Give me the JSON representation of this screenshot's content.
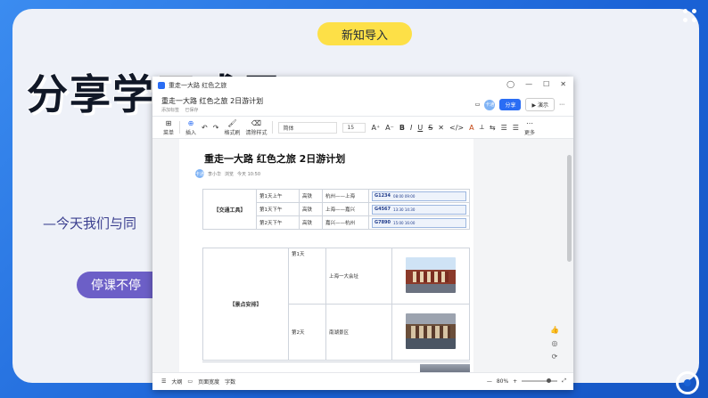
{
  "slide": {
    "pill_label": "新知导入",
    "big_title": "分享学习成果",
    "sub_text": "—今天我们与同",
    "purple_pill": "停课不停",
    "colors": {
      "background": "#1a62d6",
      "card": "#eef1f8",
      "pill": "#fde047",
      "purple": "#6c5fc7"
    }
  },
  "window": {
    "title": "重走一大路 红色之旅",
    "controls": [
      "◯",
      "—",
      "☐",
      "✕"
    ],
    "doc_name": "重走一大路 红色之旅 2日游计划",
    "doc_sub": [
      "添加标签",
      "已保存"
    ],
    "share_label": "分享",
    "present_label": "演示",
    "avatar_text": "卡通"
  },
  "toolbar": {
    "items": [
      {
        "icon": "grid-icon",
        "glyph": "⊞",
        "label": "菜单"
      },
      {
        "icon": "insert-icon",
        "glyph": "⊕",
        "label": "插入"
      },
      {
        "icon": "undo-icon",
        "glyph": "↶",
        "label": ""
      },
      {
        "icon": "redo-icon",
        "glyph": "↷",
        "label": ""
      },
      {
        "icon": "paint-icon",
        "glyph": "🖌",
        "label": "格式刷"
      },
      {
        "icon": "eraser-icon",
        "glyph": "⌫",
        "label": "清除样式"
      }
    ],
    "font": "简体",
    "size": "15",
    "format_glyphs": [
      "A⁺",
      "A⁻",
      "B",
      "I",
      "U",
      "S",
      "✕",
      "</>",
      "A",
      "⟂",
      "⇆",
      "☰",
      "☰",
      "⋯"
    ],
    "more_label": "更多"
  },
  "document": {
    "title": "重走一大路 红色之旅 2日游计划",
    "author_avatar": "卡通",
    "author": "李小华",
    "meta": "浏览",
    "time": "今天 10:50",
    "transport_label": "【交通工具】",
    "transport_rows": [
      {
        "day": "第1天上午",
        "mode": "高铁",
        "route": "杭州——上海",
        "code": "G1234",
        "times": "08:00 09:00"
      },
      {
        "day": "第1天下午",
        "mode": "高铁",
        "route": "上海——嘉兴",
        "code": "G4567",
        "times": "13:30 14:30"
      },
      {
        "day": "第2天下午",
        "mode": "高铁",
        "route": "嘉兴——杭州",
        "code": "G7890",
        "times": "15:00 16:00"
      }
    ],
    "sights_label": "【景点安排】",
    "sights_rows": [
      {
        "day": "第1天",
        "place": "上海一大会址"
      },
      {
        "day": "第2天",
        "place": "南湖景区"
      }
    ]
  },
  "statusbar": {
    "outline": "大纲",
    "page_width": "页面宽度",
    "word_count": "字数",
    "zoom": "80%",
    "zoom_fraction": 0.8
  }
}
